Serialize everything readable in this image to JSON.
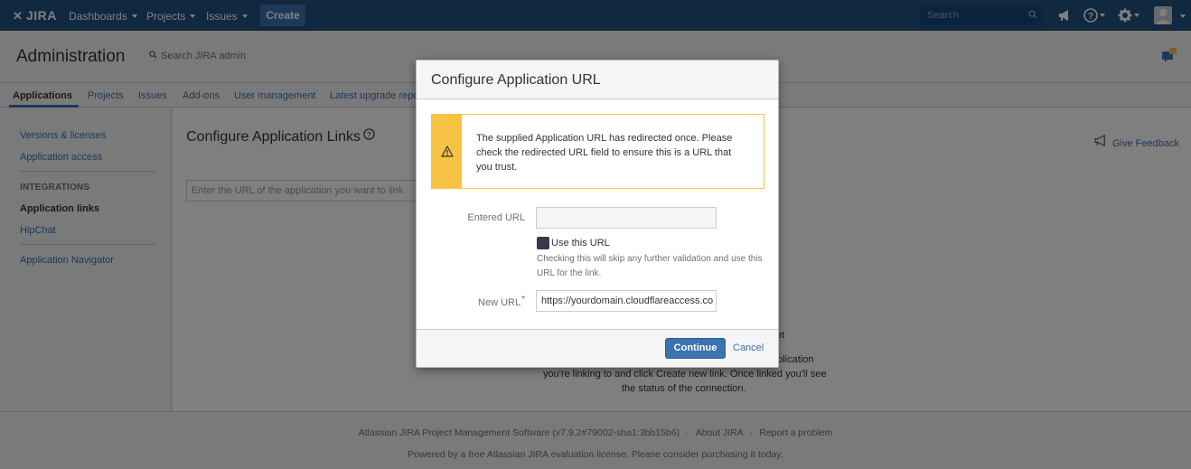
{
  "topnav": {
    "logo": "JIRA",
    "dashboards": "Dashboards",
    "projects": "Projects",
    "issues": "Issues",
    "create": "Create",
    "search_placeholder": "Search"
  },
  "admin": {
    "title": "Administration",
    "search": "Search JIRA admin"
  },
  "tabs": [
    {
      "label": "Applications"
    },
    {
      "label": "Projects"
    },
    {
      "label": "Issues"
    },
    {
      "label": "Add-ons"
    },
    {
      "label": "User management"
    },
    {
      "label": "Latest upgrade report"
    }
  ],
  "sidebar": {
    "versions_licenses": "Versions & licenses",
    "application_access": "Application access",
    "integrations_heading": "INTEGRATIONS",
    "application_links": "Application links",
    "hipchat": "HipChat",
    "application_navigator": "Application Navigator"
  },
  "main": {
    "title": "Configure Application Links",
    "url_placeholder": "Enter the URL of the application you want to link",
    "feedback": "Give Feedback",
    "bg_fragment_1": "et",
    "bg_fragment_2": "pplication",
    "bg_fragment_3": "you're linking to and click Create new link. Once linked you'll see",
    "bg_fragment_4": "the status of the connection."
  },
  "dialog": {
    "title": "Configure Application URL",
    "warning": "The supplied Application URL has redirected once. Please check the redirected URL field to ensure this is a URL that you trust.",
    "entered_url_label": "Entered URL",
    "entered_url_value": "",
    "use_url_label": "Use this URL",
    "use_url_desc": "Checking this will skip any further validation and use this URL for the link.",
    "new_url_label": "New URL",
    "new_url_value": "https://yourdomain.cloudflareaccess.co",
    "continue": "Continue",
    "cancel": "Cancel"
  },
  "footer": {
    "software": "Atlassian JIRA Project Management Software (v7.9.2#79002-sha1:3bb15b6)",
    "about": "About JIRA",
    "report": "Report a problem",
    "license": "Powered by a free Atlassian JIRA evaluation license. Please consider purchasing it today."
  },
  "colors": {
    "header": "#205081",
    "accent": "#3b73af",
    "warning": "#f6c342"
  }
}
